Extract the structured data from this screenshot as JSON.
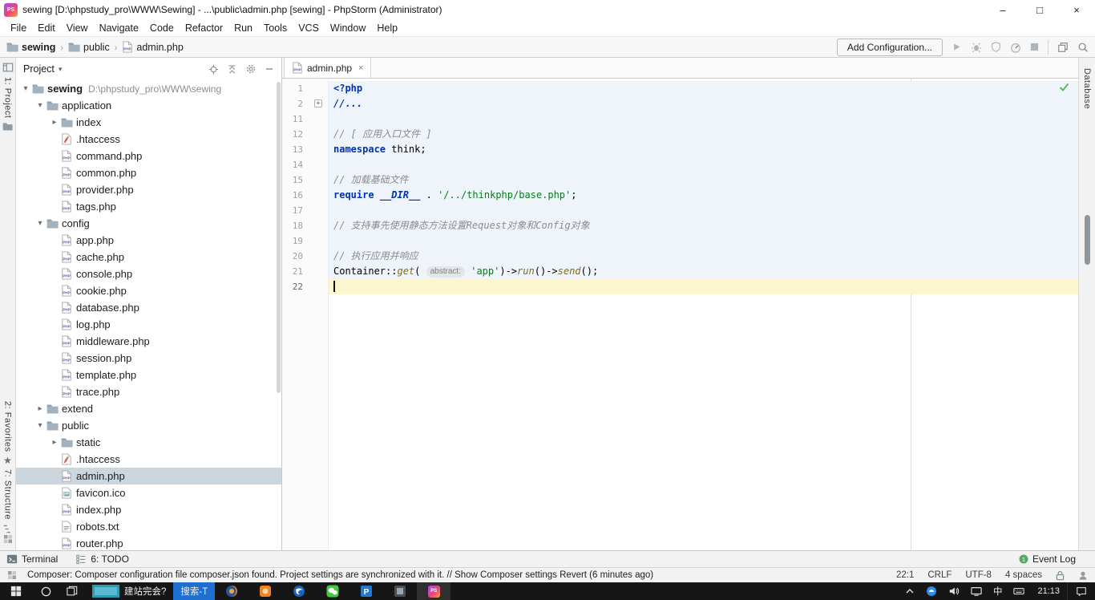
{
  "window": {
    "logo": "PS",
    "title": "sewing [D:\\phpstudy_pro\\WWW\\Sewing] - ...\\public\\admin.php [sewing] - PhpStorm (Administrator)",
    "controls": [
      "minimize",
      "maximize",
      "close"
    ]
  },
  "menu": {
    "items": [
      "File",
      "Edit",
      "View",
      "Navigate",
      "Code",
      "Refactor",
      "Run",
      "Tools",
      "VCS",
      "Window",
      "Help"
    ]
  },
  "navbar": {
    "breadcrumbs": [
      {
        "label": "sewing",
        "icon": "folder",
        "bold": true
      },
      {
        "label": "public",
        "icon": "folder"
      },
      {
        "label": "admin.php",
        "icon": "php"
      }
    ],
    "add_configuration": "Add Configuration...",
    "actions": [
      "run",
      "debug",
      "coverage",
      "profiler",
      "stop",
      "divider",
      "restore-window",
      "search"
    ]
  },
  "left_stripe": {
    "project_label": "1: Project",
    "favorites_label": "2: Favorites",
    "structure_label": "7: Structure"
  },
  "right_stripe": {
    "database_label": "Database"
  },
  "project_panel": {
    "title": "Project",
    "actions": [
      "locate",
      "collapse-all",
      "settings",
      "hide"
    ],
    "tree": [
      {
        "label": "sewing",
        "extra": "D:\\phpstudy_pro\\WWW\\sewing",
        "level": 0,
        "icon": "folder",
        "chev": "open",
        "bold": true
      },
      {
        "label": "application",
        "level": 1,
        "icon": "folder",
        "chev": "open"
      },
      {
        "label": "index",
        "level": 2,
        "icon": "folder",
        "chev": "closed"
      },
      {
        "label": ".htaccess",
        "level": 2,
        "icon": "htaccess"
      },
      {
        "label": "command.php",
        "level": 2,
        "icon": "php"
      },
      {
        "label": "common.php",
        "level": 2,
        "icon": "php"
      },
      {
        "label": "provider.php",
        "level": 2,
        "icon": "php"
      },
      {
        "label": "tags.php",
        "level": 2,
        "icon": "php"
      },
      {
        "label": "config",
        "level": 1,
        "icon": "folder",
        "chev": "open"
      },
      {
        "label": "app.php",
        "level": 2,
        "icon": "php"
      },
      {
        "label": "cache.php",
        "level": 2,
        "icon": "php"
      },
      {
        "label": "console.php",
        "level": 2,
        "icon": "php"
      },
      {
        "label": "cookie.php",
        "level": 2,
        "icon": "php"
      },
      {
        "label": "database.php",
        "level": 2,
        "icon": "php"
      },
      {
        "label": "log.php",
        "level": 2,
        "icon": "php"
      },
      {
        "label": "middleware.php",
        "level": 2,
        "icon": "php"
      },
      {
        "label": "session.php",
        "level": 2,
        "icon": "php"
      },
      {
        "label": "template.php",
        "level": 2,
        "icon": "php"
      },
      {
        "label": "trace.php",
        "level": 2,
        "icon": "php"
      },
      {
        "label": "extend",
        "level": 1,
        "icon": "folder",
        "chev": "closed"
      },
      {
        "label": "public",
        "level": 1,
        "icon": "folder",
        "chev": "open"
      },
      {
        "label": "static",
        "level": 2,
        "icon": "folder",
        "chev": "closed"
      },
      {
        "label": ".htaccess",
        "level": 2,
        "icon": "htaccess"
      },
      {
        "label": "admin.php",
        "level": 2,
        "icon": "php",
        "selected": true
      },
      {
        "label": "favicon.ico",
        "level": 2,
        "icon": "image"
      },
      {
        "label": "index.php",
        "level": 2,
        "icon": "php"
      },
      {
        "label": "robots.txt",
        "level": 2,
        "icon": "text"
      },
      {
        "label": "router.php",
        "level": 2,
        "icon": "php"
      }
    ]
  },
  "editor": {
    "tab": {
      "label": "admin.php"
    },
    "lines": [
      {
        "num": 1,
        "tint": "blue",
        "tokens": [
          {
            "t": "<?php",
            "c": "kw"
          }
        ]
      },
      {
        "num": 2,
        "tint": "blue",
        "fold": true,
        "tokens": [
          {
            "t": "//...",
            "c": "fold"
          }
        ]
      },
      {
        "num": 11,
        "tint": "blue",
        "tokens": []
      },
      {
        "num": 12,
        "tint": "blue",
        "tokens": [
          {
            "t": "// [ 应用入口文件 ]",
            "c": "cmt"
          }
        ]
      },
      {
        "num": 13,
        "tint": "blue",
        "tokens": [
          {
            "t": "namespace",
            "c": "kw"
          },
          {
            "t": " think;",
            "c": "plain"
          }
        ]
      },
      {
        "num": 14,
        "tint": "blue",
        "tokens": []
      },
      {
        "num": 15,
        "tint": "blue",
        "tokens": [
          {
            "t": "// 加载基础文件",
            "c": "cmt"
          }
        ]
      },
      {
        "num": 16,
        "tint": "blue",
        "tokens": [
          {
            "t": "require",
            "c": "kw"
          },
          {
            "t": " ",
            "c": "plain"
          },
          {
            "t": "__DIR__",
            "c": "magic"
          },
          {
            "t": " . ",
            "c": "plain"
          },
          {
            "t": "'/../thinkphp/base.php'",
            "c": "str"
          },
          {
            "t": ";",
            "c": "plain"
          }
        ]
      },
      {
        "num": 17,
        "tint": "blue",
        "tokens": []
      },
      {
        "num": 18,
        "tint": "blue",
        "tokens": [
          {
            "t": "// 支持事先使用静态方法设置Request对象和Config对象",
            "c": "cmt"
          }
        ]
      },
      {
        "num": 19,
        "tint": "blue",
        "tokens": []
      },
      {
        "num": 20,
        "tint": "blue",
        "tokens": [
          {
            "t": "// 执行应用并响应",
            "c": "cmt"
          }
        ]
      },
      {
        "num": 21,
        "tint": "blue",
        "tokens": [
          {
            "t": "Container::",
            "c": "plain"
          },
          {
            "t": "get",
            "c": "fn"
          },
          {
            "t": "( ",
            "c": "plain"
          },
          {
            "t": "abstract:",
            "c": "hint"
          },
          {
            "t": " ",
            "c": "plain"
          },
          {
            "t": "'app'",
            "c": "str"
          },
          {
            "t": ")->",
            "c": "plain"
          },
          {
            "t": "run",
            "c": "fn"
          },
          {
            "t": "()->",
            "c": "plain"
          },
          {
            "t": "send",
            "c": "fn"
          },
          {
            "t": "();",
            "c": "plain"
          }
        ]
      },
      {
        "num": 22,
        "tint": "caret",
        "caret": true,
        "tokens": []
      }
    ]
  },
  "bottom_bar": {
    "left": [
      {
        "label": "Terminal",
        "icon": "terminal"
      },
      {
        "label": "6: TODO",
        "icon": "todo"
      }
    ],
    "right": [
      {
        "label": "Event Log",
        "icon": "event",
        "badge": "1"
      }
    ]
  },
  "status_bar": {
    "message": "Composer: Composer configuration file composer.json found. Project settings are synchronized with it. // Show Composer settings Revert (6 minutes ago)",
    "caret_position": "22:1",
    "line_separator": "CRLF",
    "encoding": "UTF-8",
    "indent": "4 spaces",
    "icons": [
      "lock",
      "hector"
    ]
  },
  "taskbar": {
    "time": "21:13",
    "buttons": [
      {
        "name": "start-button",
        "icon": "windows",
        "kind": "start"
      },
      {
        "name": "search-button",
        "icon": "cortana",
        "kind": "search"
      },
      {
        "name": "task-view-button",
        "icon": "taskview",
        "kind": "taskview"
      },
      {
        "name": "window-button-1",
        "icon": "teal-window",
        "label": "建站完会?",
        "kind": "window"
      },
      {
        "name": "window-button-2",
        "label": "搜索-T",
        "kind": "window",
        "blue": true
      },
      {
        "name": "firefox-button",
        "icon": "firefox",
        "kind": "app"
      },
      {
        "name": "app-orange-button",
        "icon": "orange-app",
        "kind": "app"
      },
      {
        "name": "thunderbird-button",
        "icon": "thunderbird",
        "kind": "app"
      },
      {
        "name": "wechat-button",
        "icon": "wechat",
        "kind": "app"
      },
      {
        "name": "app-p-button",
        "icon": "p-app",
        "kind": "app"
      },
      {
        "name": "app-dark-button",
        "icon": "dark-app",
        "kind": "app"
      },
      {
        "name": "phpstorm-button",
        "icon": "phpstorm-logo",
        "kind": "app",
        "active": true
      }
    ],
    "tray": [
      {
        "name": "tray-expand",
        "icon": "chevron-up"
      },
      {
        "name": "tray-cloud-app",
        "icon": "blue-dot"
      },
      {
        "name": "tray-volume",
        "icon": "volume"
      },
      {
        "name": "tray-display",
        "icon": "network"
      },
      {
        "name": "tray-ime",
        "text": "中"
      },
      {
        "name": "tray-keyboard",
        "icon": "keyboard"
      }
    ]
  }
}
